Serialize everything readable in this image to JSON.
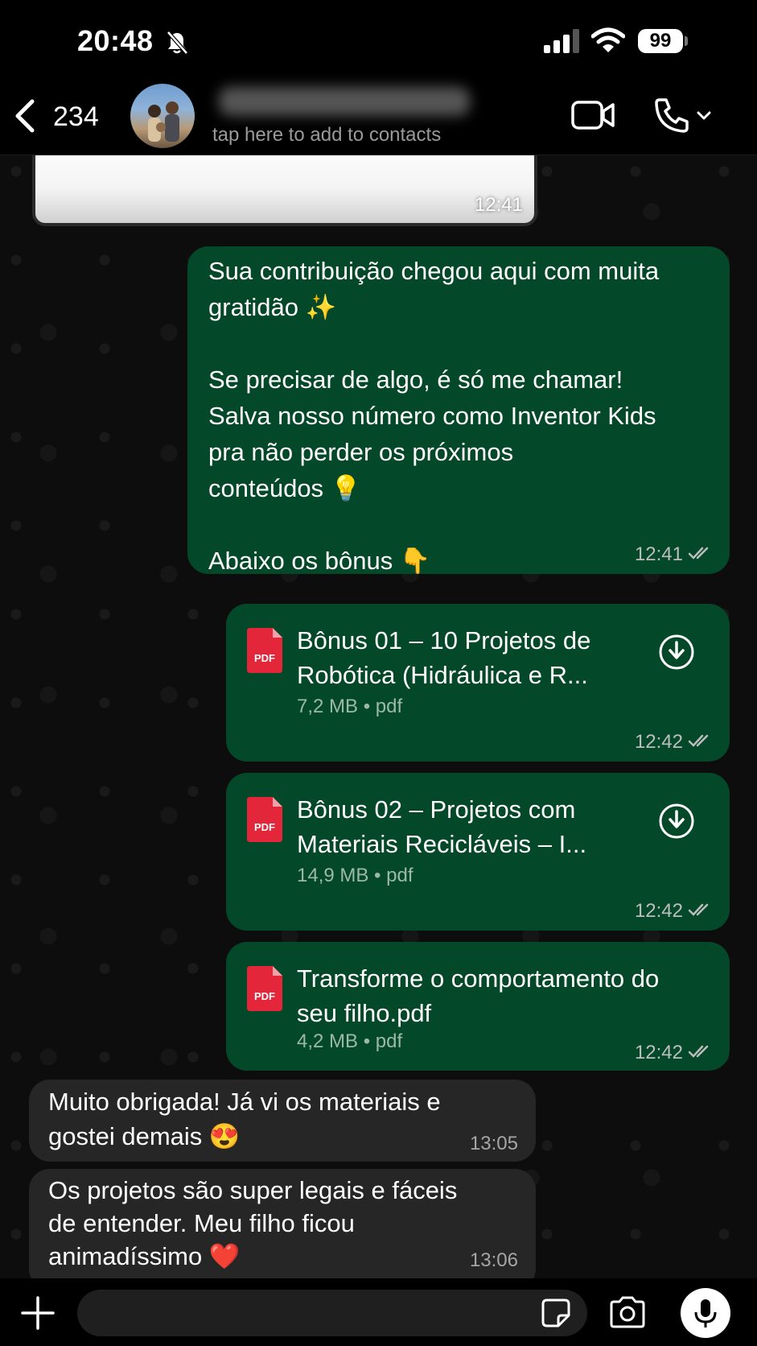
{
  "status_bar": {
    "time": "20:48",
    "battery": "99",
    "icons": [
      "bell-slash-icon",
      "signal-icon",
      "wifi-icon",
      "battery-icon"
    ]
  },
  "header": {
    "back_count": "234",
    "contact_sub": "tap here to add to contacts",
    "icons": [
      "chevron-left-icon",
      "video-icon",
      "phone-icon",
      "chevron-down-icon"
    ]
  },
  "messages": {
    "image_time": "12:41",
    "m1": {
      "text": "Sua contribuição chegou aqui com muita\ngratidão ✨\n\nSe precisar de algo, é só me chamar!\nSalva nosso número como Inventor Kids\npra não perder os próximos\nconteúdos 💡\n\nAbaixo os bônus 👇",
      "time": "12:41"
    },
    "doc1": {
      "icon_label": "PDF",
      "name": "Bônus 01 – 10 Projetos de Robótica (Hidráulica e R...",
      "size": "7,2 MB • pdf",
      "time": "12:42"
    },
    "doc2": {
      "icon_label": "PDF",
      "name": "Bônus 02 – Projetos com Materiais Recicláveis – I...",
      "size": "14,9 MB • pdf",
      "time": "12:42"
    },
    "doc3": {
      "icon_label": "PDF",
      "name": "Transforme o comportamento do seu filho.pdf",
      "size": "4,2 MB • pdf",
      "time": "12:42"
    },
    "in1": {
      "text": "Muito obrigada! Já vi os materiais e\ngostei demais 😍",
      "time": "13:05"
    },
    "in2": {
      "text": "Os projetos são super legais e fáceis\nde entender. Meu filho ficou\nanimadíssimo ❤️",
      "time": "13:06"
    }
  },
  "input_bar": {
    "placeholder": "",
    "icons": [
      "plus-icon",
      "sticker-icon",
      "camera-icon",
      "microphone-icon"
    ]
  },
  "colors": {
    "outgoing_bubble": "#04482a",
    "incoming_bubble": "#262626",
    "pdf_red": "#e3263a",
    "background": "#0d0d0d"
  }
}
